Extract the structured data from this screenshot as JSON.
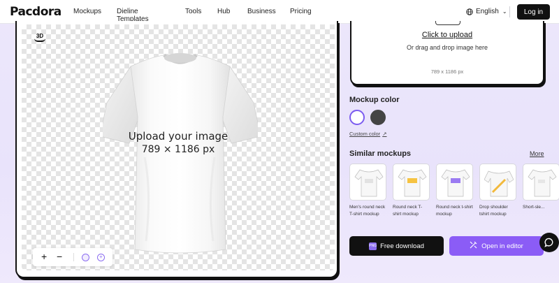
{
  "nav": {
    "logo": "Pacdora",
    "links": [
      "Mockups",
      "Dieline Templates",
      "Tools",
      "Hub",
      "Business",
      "Pricing"
    ],
    "language": "English",
    "login": "Log in"
  },
  "canvas": {
    "badge": "3D",
    "placeholder_line1": "Upload your image",
    "placeholder_line2": "789 × 1186 px",
    "zoom_in": "+",
    "zoom_out": "−"
  },
  "upload": {
    "title": "Click to upload",
    "subtitle": "Or drag and drop image here",
    "dimensions": "789 x 1186 px"
  },
  "mockup_color": {
    "title": "Mockup color",
    "colors": [
      "#ffffff",
      "#444444"
    ],
    "custom_label": "Custom color",
    "custom_arrow": "↗"
  },
  "similar": {
    "title": "Similar mockups",
    "more": "More",
    "items": [
      "Men's round neck T-shirt mockup",
      "Round neck T-shirt mockup",
      "Round neck t-shirt mockup",
      "Drop shoulder tshirt mockup",
      "Short-sle..."
    ]
  },
  "actions": {
    "download": "Free download",
    "download_badge": "PNG",
    "editor": "Open in editor"
  },
  "colors": {
    "accent": "#8b5cf6",
    "dark": "#111111"
  }
}
